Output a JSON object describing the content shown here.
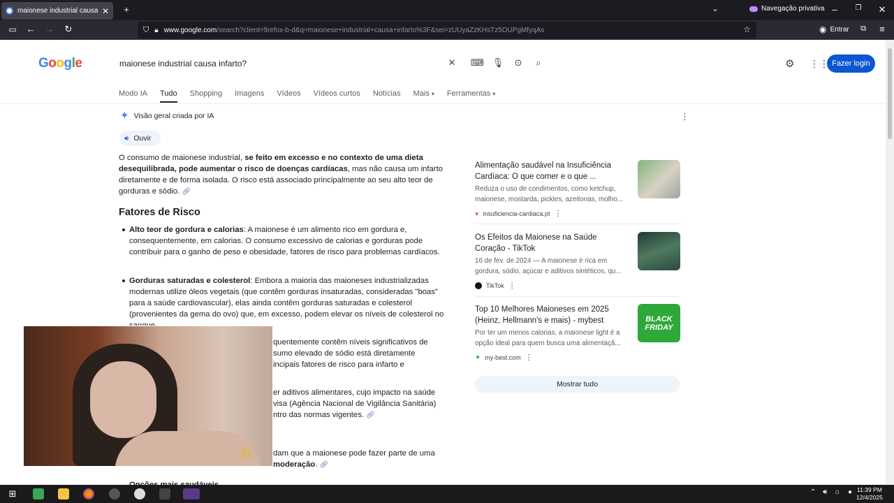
{
  "browser": {
    "tab_title": "maionese industrial causa infarto",
    "private_label": "Navegação privativa",
    "url_host": "www.google.com",
    "url_rest": "/search?client=firefox-b-d&q=maionese+industrial+causa+infarto%3F&sei=zUUyaZzKHsTz5OUPgMfyqAs",
    "signin_label": "Entrar"
  },
  "google": {
    "logo_text": "Google",
    "query": "maionese industrial causa infarto?",
    "login_label": "Fazer login",
    "tabs": [
      "Modo IA",
      "Tudo",
      "Shopping",
      "Imagens",
      "Vídeos",
      "Vídeos curtos",
      "Notícias",
      "Mais",
      "Ferramentas"
    ]
  },
  "ai_overview": {
    "header": "Visão geral criada por IA",
    "listen_label": "Ouvir",
    "intro_normal_1": "O consumo de maionese industrial, ",
    "intro_bold": "se feito em excesso e no contexto de uma dieta desequilibrada, pode aumentar o risco de doenças cardíacas",
    "intro_normal_2": ", mas não causa um infarto diretamente e de forma isolada. O risco está associado principalmente ao seu alto teor de gorduras e sódio.",
    "risk_title": "Fatores de Risco",
    "b1_bold": "Alto teor de gordura e calorias",
    "b1_text": ": A maionese é um alimento rico em gordura e, consequentemente, em calorias. O consumo excessivo de calorias e gorduras pode contribuir para o ganho de peso e obesidade, fatores de risco para problemas cardíacos.",
    "b2_bold": "Gorduras saturadas e colesterol",
    "b2_text": ": Embora a maioria das maioneses industrializadas modernas utilize óleos vegetais (que contêm gorduras insaturadas, consideradas \"boas\" para a saúde cardiovascular), elas ainda contêm gorduras saturadas e colesterol (provenientes da gema do ovo) que, em excesso, podem elevar os níveis de colesterol no sangue.",
    "b3_partial": "quentemente contêm níveis significativos de",
    "b3_partial_2": "sumo elevado de sódio está diretamente",
    "b3_partial_3": "incipais fatores de risco para infarto e",
    "b4_partial": "er aditivos alimentares, cujo impacto na saúde",
    "b4_partial_2": "visa (Agência Nacional de Vigilância Sanitária)",
    "b4_partial_3": "ntro das normas vigentes.",
    "concl_partial": "dam que a maionese pode fazer parte de uma",
    "concl_bold": "moderação",
    "next_partial": "Opções mais saudáveis"
  },
  "sources": [
    {
      "title": "Alimentação saudável na Insuficiência Cardíaca: O que comer e o que ...",
      "snippet": "Reduza o uso de condimentos, como ketchup, maionese, mostarda, pickles, azeitonas, molho...",
      "site": "insuficiencia-cardiaca.pt"
    },
    {
      "title": "Os Efeitos da Maionese na Saúde Coração - TikTok",
      "snippet": "16 de fev. de 2024 — A maionese é rica em gordura, sódio, açúcar e aditivos sintéticos, qu...",
      "site": "TikTok"
    },
    {
      "title": "Top 10 Melhores Maioneses em 2025 (Heinz, Hellmann's e mais) - mybest",
      "snippet": "Por ter um menos calorias, a maionese light é a opção ideal para quem busca uma alimentaçã...",
      "site": "my-best.com",
      "thumb_text": "BLACK FRIDAY"
    }
  ],
  "show_all_label": "Mostrar tudo",
  "taskbar": {
    "time": "11:39 PM",
    "date": "12/4/2025"
  },
  "colors": {
    "accent_blue": "#0b57d0",
    "ai_pill": "#eef3fc",
    "tab_bg": "#42414d",
    "toolbar_bg": "#2b2a33"
  }
}
